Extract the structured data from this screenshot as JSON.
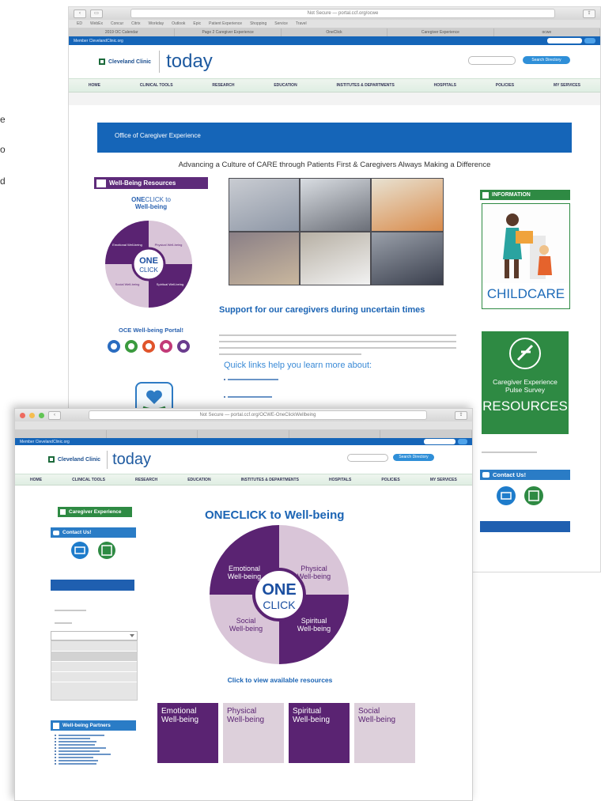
{
  "edge_letters": [
    "e",
    "o",
    "d"
  ],
  "back_window": {
    "url": "Not Secure — portal.ccf.org/ocwe",
    "bookmarks": [
      "ED",
      "WebEx",
      "Concur",
      "Citrix",
      "Workday",
      "Outlook",
      "Epic",
      "Patient Experience",
      "Shopping",
      "Service",
      "Travel"
    ],
    "tabs": [
      "2019 OC Calendar",
      "Page 2 Caregiver Experience",
      "OneClick",
      "Caregiver Experience",
      "ocwe"
    ],
    "member_link": "Member ClevelandClinic.org",
    "logo": "Cleveland Clinic",
    "today": "today",
    "search_button": "Search Directory",
    "nav": [
      "HOME",
      "CLINICAL TOOLS",
      "RESEARCH",
      "EDUCATION",
      "INSTITUTES & DEPARTMENTS",
      "HOSPITALS",
      "POLICIES",
      "MY SERVICES"
    ],
    "banner": "Office of Caregiver Experience",
    "tagline": "Advancing a Culture of CARE through Patients First & Caregivers Always Making a Difference",
    "wellbeing_header": "Well-Being Resources",
    "oneclick_title_bold": "ONE",
    "oneclick_title_rest": "CLICK to",
    "oneclick_title_line2": "Well-being",
    "wheel_small": {
      "emotional": "Emotional Well-being",
      "physical": "Physical Well-being",
      "social": "Social Well-being",
      "spiritual": "Spiritual Well-being",
      "one": "ONE",
      "click": "CLICK"
    },
    "portal_title": "OCE Well-being Portal!",
    "portal_icon_colors": [
      "#2a6cc0",
      "#3a9a3e",
      "#e0542b",
      "#c23a78",
      "#6a3c8e"
    ],
    "support_heading": "Support for our caregivers during uncertain times",
    "quick_links": "Quick links help you learn more about:",
    "info_header": "INFORMATION",
    "childcare": "CHILDCARE",
    "survey_line1": "Caregiver Experience",
    "survey_line2": "Pulse Survey",
    "resources": "RESOURCES",
    "contact_header": "Contact Us!"
  },
  "front_window": {
    "url": "Not Secure — portal.ccf.org/OCWE-OneClickWellbeing",
    "member_link": "Member ClevelandClinic.org",
    "logo": "Cleveland Clinic",
    "today": "today",
    "search_button": "Search Directory",
    "nav": [
      "HOME",
      "CLINICAL TOOLS",
      "RESEARCH",
      "EDUCATION",
      "INSTITUTES & DEPARTMENTS",
      "HOSPITALS",
      "POLICIES",
      "MY SERVICES"
    ],
    "caregiver_exp": "Caregiver Experience",
    "contact_header": "Contact Us!",
    "partners_header": "Well-being Partners",
    "oneclick_bold": "ONE",
    "oneclick_rest": "CLICK to Well-being",
    "wheel": {
      "emotional_1": "Emotional",
      "emotional_2": "Well-being",
      "physical_1": "Physical",
      "physical_2": "Well-being",
      "social_1": "Social",
      "social_2": "Well-being",
      "spiritual_1": "Spiritual",
      "spiritual_2": "Well-being",
      "one": "ONE",
      "click": "CLICK"
    },
    "click_to_view": "Click to view available resources",
    "tiles": [
      {
        "line1": "Emotional",
        "line2": "Well-being"
      },
      {
        "line1": "Physical",
        "line2": "Well-being"
      },
      {
        "line1": "Spiritual",
        "line2": "Well-being"
      },
      {
        "line1": "Social",
        "line2": "Well-being"
      }
    ]
  },
  "colors": {
    "dark_purple": "#5a2372",
    "light_purple": "#d9c5d8",
    "tile_light": "#ddd0db",
    "cc_blue": "#1565b8",
    "heading_blue": "#1b64b4",
    "green": "#2e8a43"
  }
}
